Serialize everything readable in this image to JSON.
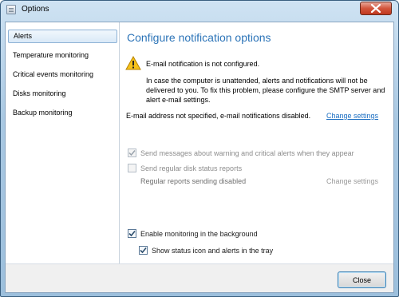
{
  "window": {
    "title": "Options",
    "icons": {
      "app": "options-app-icon",
      "close": "close-x-icon"
    }
  },
  "sidebar": {
    "items": [
      {
        "label": "Alerts",
        "active": true
      },
      {
        "label": "Temperature monitoring",
        "active": false
      },
      {
        "label": "Critical events monitoring",
        "active": false
      },
      {
        "label": "Disks monitoring",
        "active": false
      },
      {
        "label": "Backup monitoring",
        "active": false
      }
    ]
  },
  "content": {
    "heading": "Configure notification options",
    "warning": {
      "icon": "warning-triangle-icon",
      "title": "E-mail notification is not configured.",
      "description": "In case the computer is unattended, alerts and notifications will not be delivered to you. To fix this problem, please configure the SMTP server and alert e-mail settings."
    },
    "email_status": "E-mail address not specified, e-mail notifications disabled.",
    "change_settings_label": "Change settings",
    "send_warning_alerts": {
      "label": "Send messages about warning and critical alerts when they appear",
      "checked": true,
      "enabled": false
    },
    "send_disk_reports": {
      "label": "Send regular disk status reports",
      "checked": false,
      "enabled": false
    },
    "reports_status": "Regular reports sending disabled",
    "reports_change_settings_label": "Change settings",
    "enable_monitoring": {
      "label": "Enable monitoring in the background",
      "checked": true,
      "enabled": true
    },
    "show_tray_icon": {
      "label": "Show status icon and alerts in the tray",
      "checked": true,
      "enabled": true
    }
  },
  "footer": {
    "close_label": "Close"
  },
  "colors": {
    "accent": "#2c74b8",
    "link": "#1b6ec2",
    "warning": "#f2b500"
  }
}
